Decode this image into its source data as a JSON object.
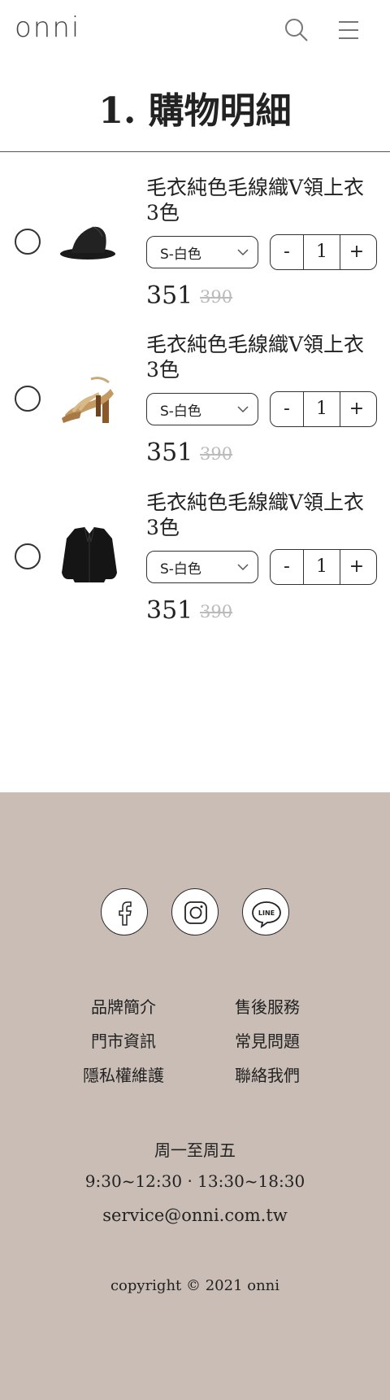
{
  "header": {
    "logo": "onni",
    "search_icon": "search-icon",
    "menu_icon": "hamburger-menu-icon"
  },
  "page_title": "1. 購物明細",
  "cart": {
    "items": [
      {
        "name": "毛衣純色毛線織V領上衣 3色",
        "variant": "S-白色",
        "qty": "1",
        "price": "351",
        "original_price": "390",
        "image": "black-hat"
      },
      {
        "name": "毛衣純色毛線織V領上衣 3色",
        "variant": "S-白色",
        "qty": "1",
        "price": "351",
        "original_price": "390",
        "image": "sandal-heels"
      },
      {
        "name": "毛衣純色毛線織V領上衣 3色",
        "variant": "S-白色",
        "qty": "1",
        "price": "351",
        "original_price": "390",
        "image": "black-jacket"
      }
    ],
    "qty_minus": "-",
    "qty_plus": "+"
  },
  "footer": {
    "social": [
      "facebook-icon",
      "instagram-icon",
      "line-icon"
    ],
    "line_label": "LINE",
    "links": [
      "品牌簡介",
      "售後服務",
      "門市資訊",
      "常見問題",
      "隱私權維護",
      "聯絡我們"
    ],
    "hours_days": "周一至周五",
    "hours_times": "9:30~12:30 ‧ 13:30~18:30",
    "email": "service@onni.com.tw",
    "copyright": "copyright © 2021 onni",
    "background": "#c9bdb5"
  }
}
